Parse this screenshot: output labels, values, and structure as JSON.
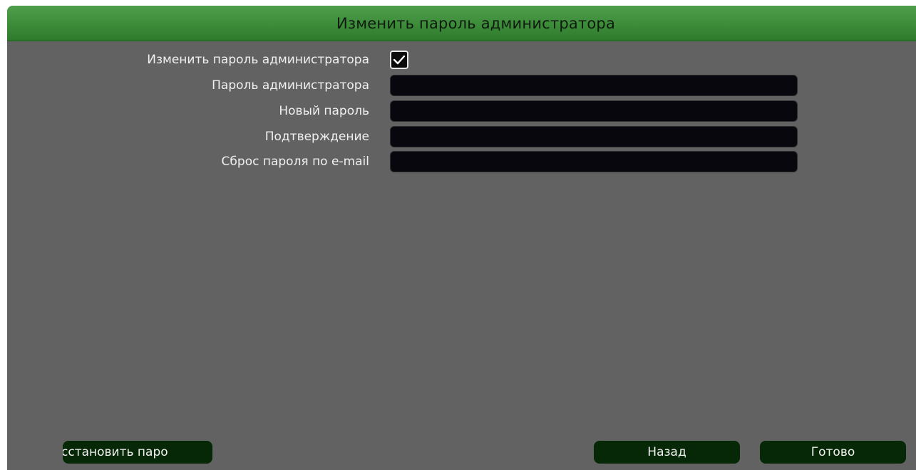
{
  "dialog": {
    "title": "Изменить пароль администратора"
  },
  "form": {
    "change_password": {
      "label": "Изменить пароль администратора",
      "checked": true
    },
    "admin_password": {
      "label": "Пароль администратора",
      "value": ""
    },
    "new_password": {
      "label": "Новый пароль",
      "value": ""
    },
    "confirm": {
      "label": "Подтверждение",
      "value": ""
    },
    "email_reset": {
      "label": "Сброс пароля по e-mail",
      "value": ""
    }
  },
  "buttons": {
    "restore_label": "сстановить паро",
    "back_label": "Назад",
    "done_label": "Готово"
  },
  "colors": {
    "titlebar": "#3a8a38",
    "panel": "#626262",
    "field": "#07070d",
    "button": "#062806"
  },
  "icons": {
    "checkbox": "checkmark-icon"
  }
}
